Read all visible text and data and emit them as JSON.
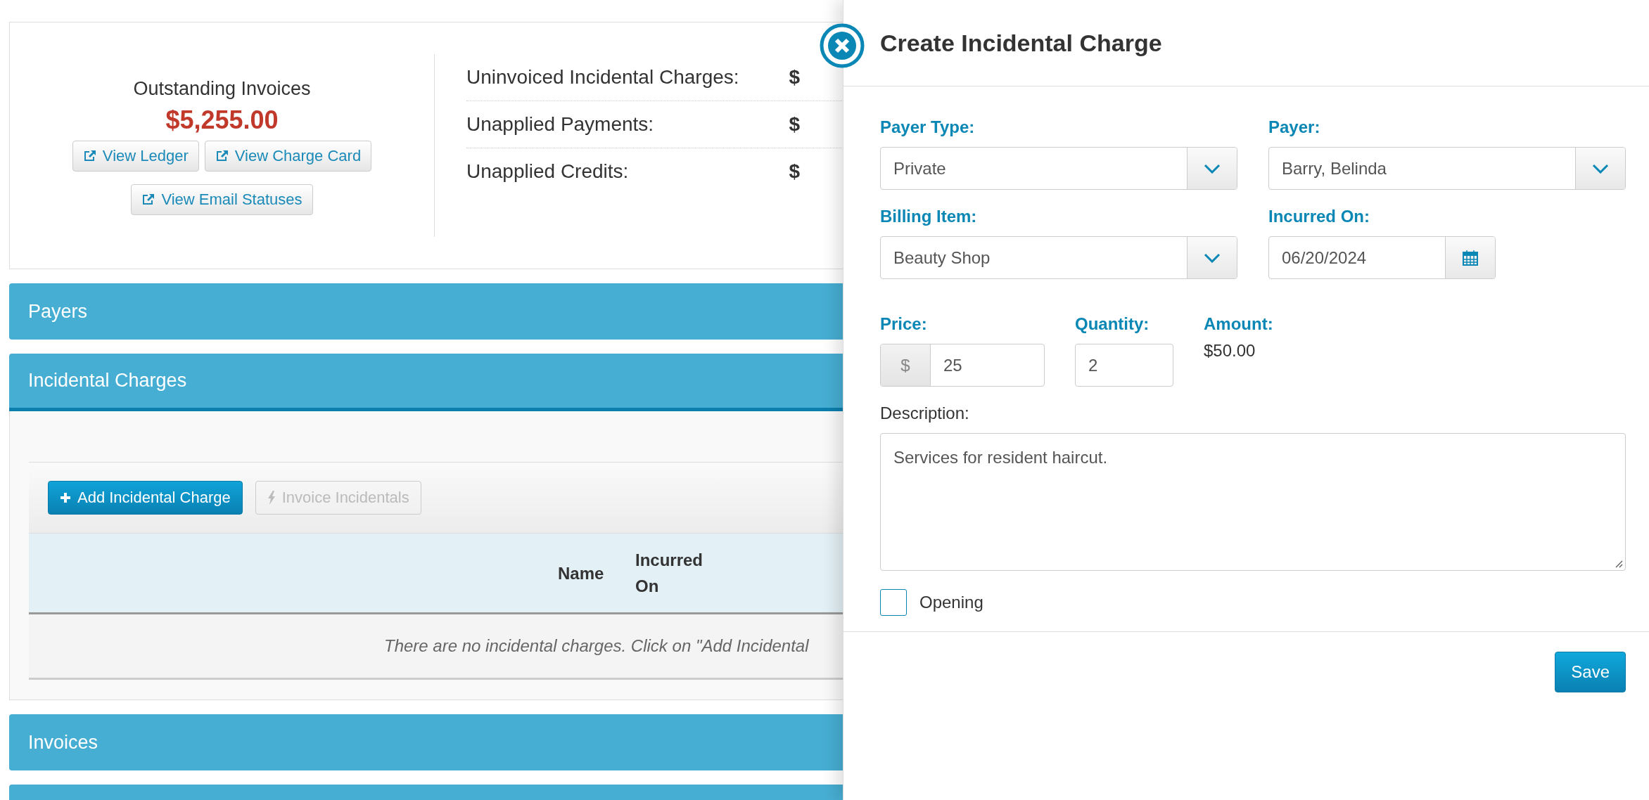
{
  "summary": {
    "outstanding": {
      "label": "Outstanding Invoices",
      "amount": "$5,255.00",
      "buttons": [
        {
          "label": "View Ledger"
        },
        {
          "label": "View Charge Card"
        },
        {
          "label": "View Email Statuses"
        }
      ]
    },
    "balances": [
      {
        "label": "Uninvoiced Incidental Charges:",
        "value": "$"
      },
      {
        "label": "Unapplied Payments:",
        "value": "$"
      },
      {
        "label": "Unapplied Credits:",
        "value": "$"
      }
    ]
  },
  "sections": [
    {
      "kind": "bar",
      "title": "Payers"
    },
    {
      "kind": "panel",
      "title": "Incidental Charges",
      "toolbar": [
        {
          "label": "Add Incidental Charge",
          "disabled": false
        },
        {
          "label": "Invoice Incidentals",
          "disabled": true
        }
      ],
      "table": {
        "columns": [
          "Name",
          "Incurred On"
        ],
        "empty_message": "There are no incidental charges. Click on \"Add Incidental"
      }
    },
    {
      "kind": "bar",
      "title": "Invoices"
    },
    {
      "kind": "bar"
    }
  ],
  "drawer": {
    "title": "Create Incidental Charge",
    "rows": [
      [
        {
          "kind": "select",
          "label": "Payer Type:",
          "value": "Private"
        },
        {
          "kind": "select",
          "label": "Payer:",
          "value": "Barry, Belinda"
        }
      ],
      [
        {
          "kind": "select",
          "label": "Billing Item:",
          "value": "Beauty Shop"
        },
        {
          "kind": "date",
          "label": "Incurred On:",
          "value": "06/20/2024"
        }
      ],
      [
        {
          "kind": "price",
          "label": "Price:",
          "prefix": "$",
          "value": "25"
        },
        {
          "kind": "number",
          "label": "Quantity:",
          "value": "2"
        },
        {
          "kind": "readout",
          "label": "Amount:",
          "value": "$50.00"
        }
      ]
    ],
    "description": {
      "label": "Description:",
      "value": "Services for resident haircut."
    },
    "checkbox": {
      "label": "Opening",
      "checked": false
    },
    "save_button": "Save"
  }
}
